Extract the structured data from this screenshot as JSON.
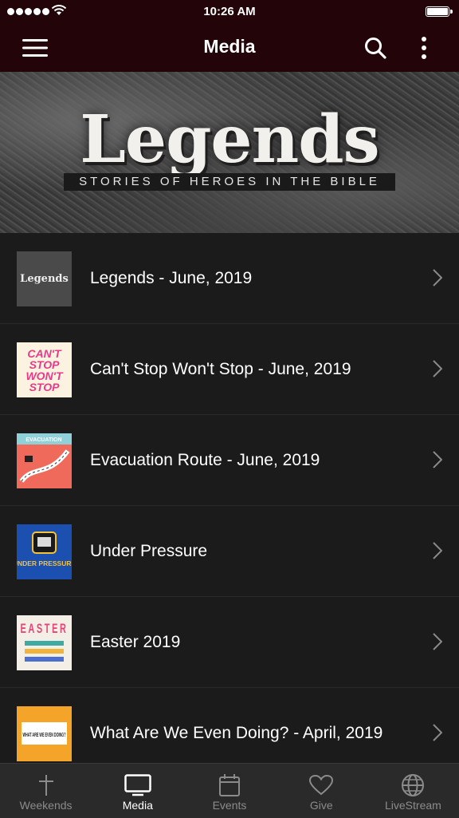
{
  "status": {
    "time": "10:26 AM"
  },
  "nav": {
    "title": "Media",
    "menu_icon": "hamburger-icon",
    "search_icon": "search-icon",
    "more_icon": "more-vertical-icon"
  },
  "hero": {
    "title": "Legends",
    "subtitle": "STORIES OF HEROES IN THE BIBLE"
  },
  "items": [
    {
      "label": "Legends - June, 2019",
      "thumb_text": "Legends"
    },
    {
      "label": "Can't Stop Won't Stop - June, 2019",
      "thumb_text": "CAN'T STOP WON'T STOP"
    },
    {
      "label": "Evacuation Route - June, 2019",
      "thumb_text": "EVACUATION"
    },
    {
      "label": "Under Pressure",
      "thumb_text": "UNDER PRESSURE"
    },
    {
      "label": "Easter 2019",
      "thumb_text": "EASTER"
    },
    {
      "label": "What Are We Even Doing? - April, 2019",
      "thumb_text": "WHAT ARE WE EVEN DOING?"
    }
  ],
  "tabs": [
    {
      "label": "Weekends",
      "icon": "plus-icon"
    },
    {
      "label": "Media",
      "icon": "tv-icon",
      "active": true
    },
    {
      "label": "Events",
      "icon": "calendar-icon"
    },
    {
      "label": "Give",
      "icon": "heart-icon"
    },
    {
      "label": "LiveStream",
      "icon": "globe-icon"
    }
  ]
}
